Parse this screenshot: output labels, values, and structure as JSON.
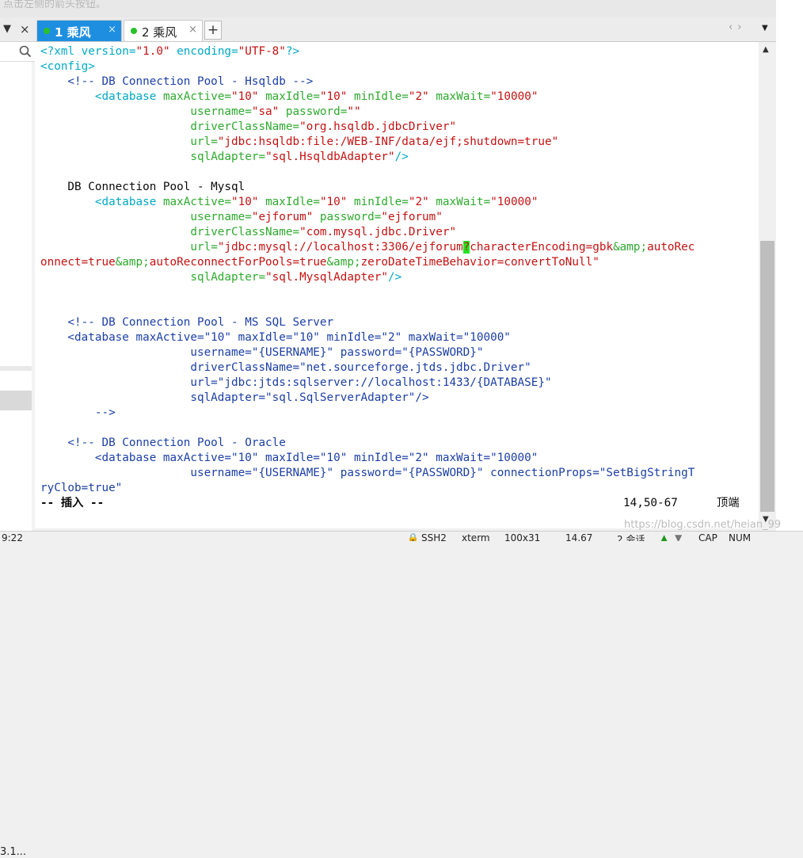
{
  "hint_text": "点击左侧的箭头按钮。",
  "left_pane": {
    "pin_glyph": "▼",
    "close_glyph": "×",
    "item_partial": "3.1..."
  },
  "tabs": [
    {
      "label": "1 乘风",
      "close": "×"
    },
    {
      "label": "2 乘风",
      "close": "×"
    }
  ],
  "add_tab_glyph": "+",
  "nav_arrows": "‹›",
  "tab_menu_glyph": "▼",
  "editor": {
    "l1": {
      "p1": "<?xml version=",
      "v1": "\"1.0\"",
      "p2": " encoding=",
      "v2": "\"UTF-8\"",
      "p3": "?>"
    },
    "l2": "<config>",
    "l3": "    <!-- DB Connection Pool - Hsqldb -->",
    "l4": {
      "tag": "<database",
      "a1": "maxActive=",
      "v1": "\"10\"",
      "a2": "maxIdle=",
      "v2": "\"10\"",
      "a3": "minIdle=",
      "v3": "\"2\"",
      "a4": "maxWait=",
      "v4": "\"10000\""
    },
    "l5": {
      "a1": "username=",
      "v1": "\"sa\"",
      "a2": "password=",
      "v2": "\"\""
    },
    "l6": {
      "a": "driverClassName=",
      "v": "\"org.hsqldb.jdbcDriver\""
    },
    "l7": {
      "a": "url=",
      "v": "\"jdbc:hsqldb:file:/WEB-INF/data/ejf;shutdown=true\""
    },
    "l8": {
      "a": "sqlAdapter=",
      "v": "\"sql.HsqldbAdapter\"",
      "end": "/>"
    },
    "l10": "    DB Connection Pool - Mysql",
    "l11": {
      "tag": "<database",
      "a1": "maxActive=",
      "v1": "\"10\"",
      "a2": "maxIdle=",
      "v2": "\"10\"",
      "a3": "minIdle=",
      "v3": "\"2\"",
      "a4": "maxWait=",
      "v4": "\"10000\""
    },
    "l12": {
      "a1": "username=",
      "v1": "\"ejforum\"",
      "a2": "password=",
      "v2": "\"ejforum\""
    },
    "l13": {
      "a": "driverClassName=",
      "v": "\"com.mysql.jdbc.Driver\""
    },
    "l14": {
      "a": "url=",
      "v1": "\"jdbc:mysql://localhost:3306/ejforum",
      "cur": "?",
      "v2": "characterEncoding=gbk",
      "ref": "&amp;",
      "v3": "autoRec"
    },
    "l15": {
      "v1": "onnect=true",
      "ref1": "&amp;",
      "v2": "autoReconnectForPools=true",
      "ref2": "&amp;",
      "v3": "zeroDateTimeBehavior=convertToNull\""
    },
    "l16": {
      "a": "sqlAdapter=",
      "v": "\"sql.MysqlAdapter\"",
      "end": "/>"
    },
    "l19": "    <!-- DB Connection Pool - MS SQL Server",
    "l20": "    <database maxActive=\"10\" maxIdle=\"10\" minIdle=\"2\" maxWait=\"10000\"",
    "l21": "                      username=\"{USERNAME}\" password=\"{PASSWORD}\"",
    "l22": "                      driverClassName=\"net.sourceforge.jtds.jdbc.Driver\"",
    "l23": "                      url=\"jdbc:jtds:sqlserver://localhost:1433/{DATABASE}\"",
    "l24": "                      sqlAdapter=\"sql.SqlServerAdapter\"/>",
    "l25": "        -->",
    "l27": "    <!-- DB Connection Pool - Oracle",
    "l28": "        <database maxActive=\"10\" maxIdle=\"10\" minIdle=\"2\" maxWait=\"10000\"",
    "l29": "                      username=\"{USERNAME}\" password=\"{PASSWORD}\" connectionProps=\"SetBigStringT",
    "l30": "ryClob=true\"",
    "status_line": {
      "mode": "-- 插入 --",
      "pos": "14,50-67",
      "where": "顶端"
    }
  },
  "status_bar": {
    "time": "9:22",
    "items": [
      "SSH2",
      "xterm",
      "100x31",
      "14,67",
      "2 会话",
      "CAP",
      "NUM"
    ]
  },
  "watermark": "https://blog.csdn.net/heian_99"
}
